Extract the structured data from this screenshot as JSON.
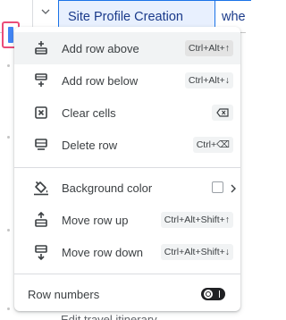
{
  "sheet": {
    "header_cell": "Site Profile Creation",
    "next_cell": "whe",
    "bottom_peek": "Edit travel itinerary"
  },
  "menu": {
    "items": [
      {
        "label": "Add row above",
        "shortcut": "Ctrl+Alt+↑",
        "icon": "add-row-above-icon"
      },
      {
        "label": "Add row below",
        "shortcut": "Ctrl+Alt+↓",
        "icon": "add-row-below-icon"
      },
      {
        "label": "Clear cells",
        "shortcut": "⌫",
        "icon": "clear-cells-icon"
      },
      {
        "label": "Delete row",
        "shortcut": "Ctrl+⌫",
        "icon": "delete-row-icon"
      },
      {
        "label": "Background color",
        "icon": "paint-bucket-icon"
      },
      {
        "label": "Move row up",
        "shortcut": "Ctrl+Alt+Shift+↑",
        "icon": "move-row-up-icon"
      },
      {
        "label": "Move row down",
        "shortcut": "Ctrl+Alt+Shift+↓",
        "icon": "move-row-down-icon"
      },
      {
        "label": "Row numbers",
        "toggle": "off"
      }
    ]
  },
  "colors": {
    "menu_bg": "#ffffff",
    "hover_bg": "#f1f3f4",
    "selection_blue": "#1a73e8",
    "highlight_pink": "#ea4c78"
  }
}
